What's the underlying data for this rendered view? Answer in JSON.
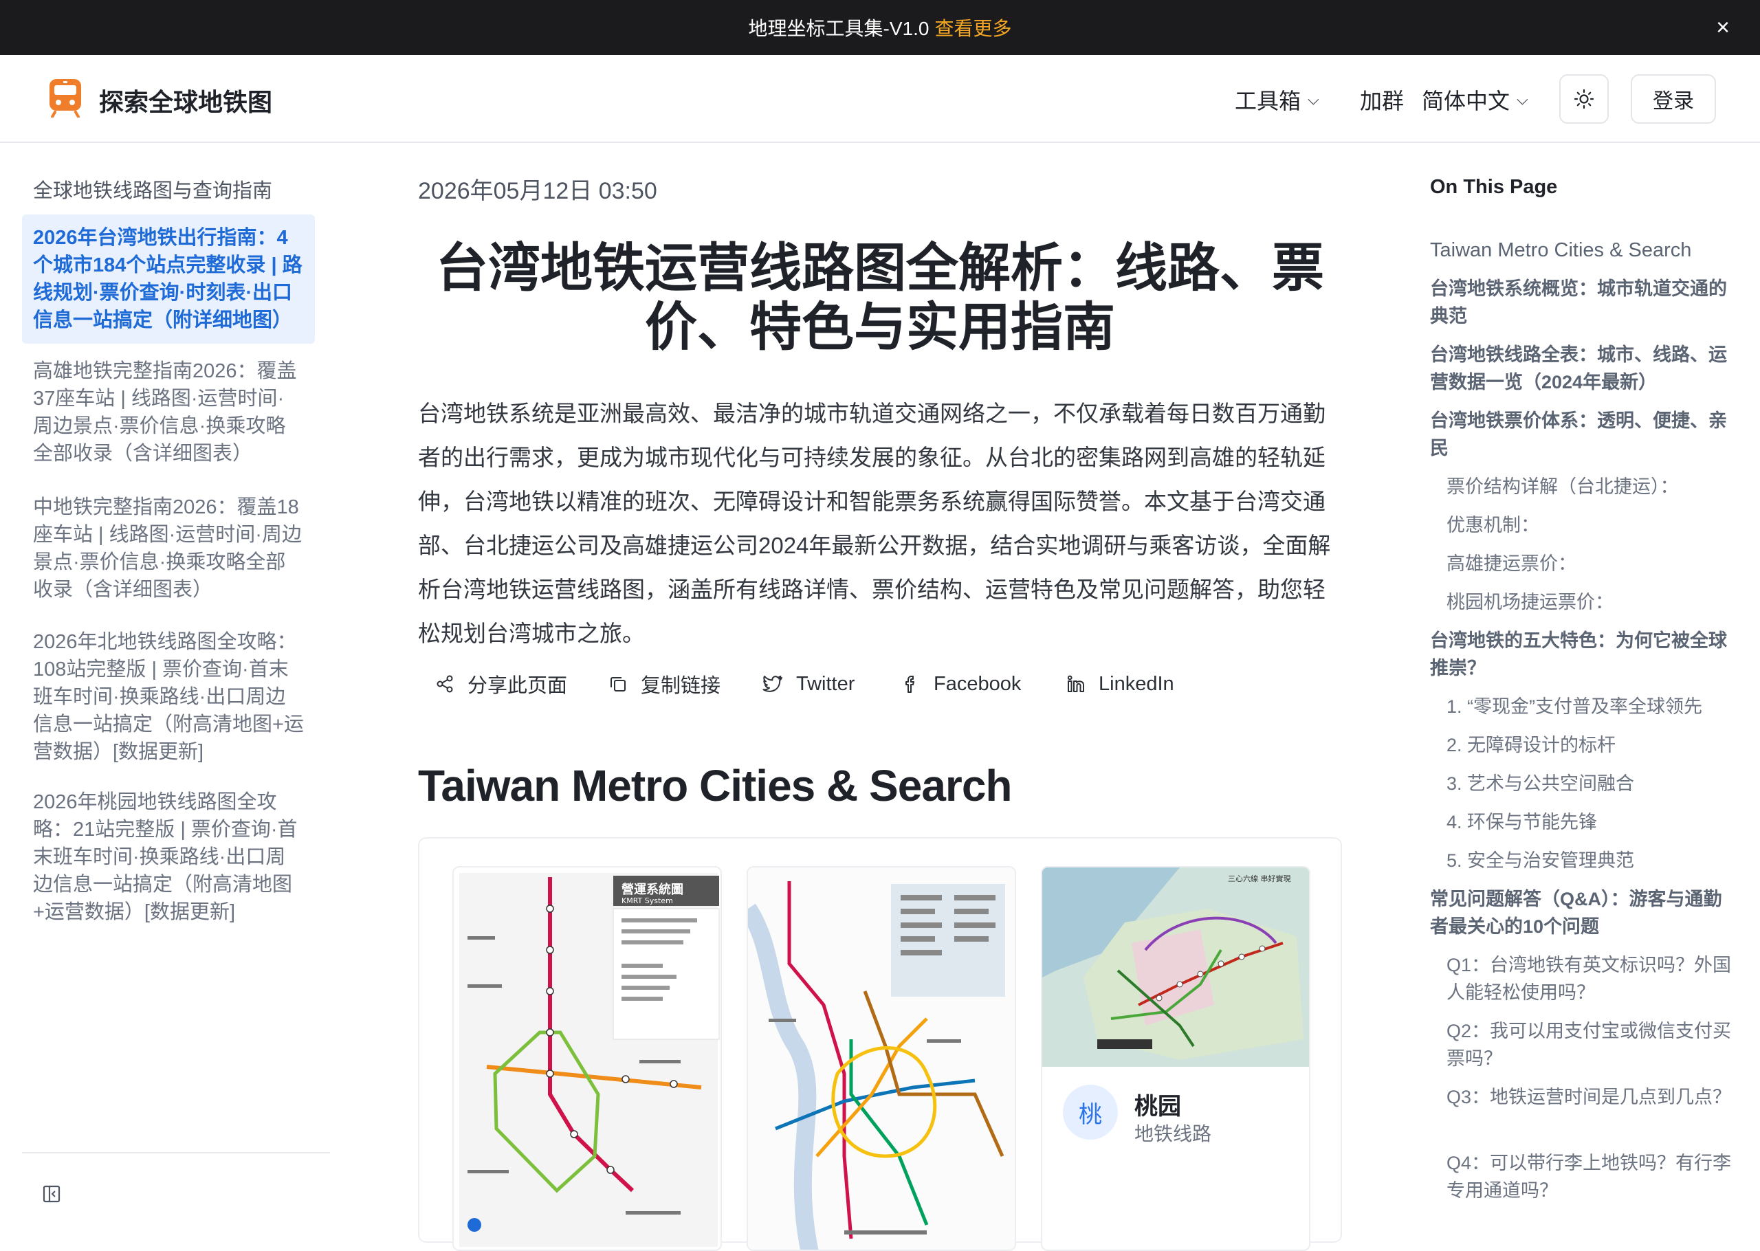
{
  "banner": {
    "text": "地理坐标工具集-V1.0",
    "link": "查看更多",
    "close": "×"
  },
  "header": {
    "site_title": "探索全球地铁图",
    "nav": {
      "toolbox": "工具箱",
      "join_group": "加群",
      "language": "简体中文",
      "login": "登录"
    }
  },
  "sidebar": {
    "heading": "全球地铁线路图与查询指南",
    "items": [
      {
        "label": "2026年台湾地铁出行指南：4个城市184个站点完整收录 | 路线规划·票价查询·时刻表·出口信息一站搞定（附详细地图）",
        "active": true
      },
      {
        "label": "高雄地铁完整指南2026：覆盖37座车站 | 线路图·运营时间·周边景点·票价信息·换乘攻略全部收录（含详细图表）"
      },
      {
        "label": "中地铁完整指南2026：覆盖18座车站 | 线路图·运营时间·周边景点·票价信息·换乘攻略全部收录（含详细图表）"
      },
      {
        "label": "2026年北地铁线路图全攻略：108站完整版 | 票价查询·首末班车时间·换乘路线·出口周边信息一站搞定（附高清地图+运营数据）[数据更新]"
      },
      {
        "label": "2026年桃园地铁线路图全攻略：21站完整版 | 票价查询·首末班车时间·换乘路线·出口周边信息一站搞定（附高清地图+运营数据）[数据更新]"
      }
    ]
  },
  "article": {
    "date": "2026年05月12日 03:50",
    "title": "台湾地铁运营线路图全解析：线路、票价、特色与实用指南",
    "intro": "台湾地铁系统是亚洲最高效、最洁净的城市轨道交通网络之一，不仅承载着每日数百万通勤者的出行需求，更成为城市现代化与可持续发展的象征。从台北的密集路网到高雄的轻轨延伸，台湾地铁以精准的班次、无障碍设计和智能票务系统赢得国际赞誉。本文基于台湾交通部、台北捷运公司及高雄捷运公司2024年最新公开数据，结合实地调研与乘客访谈，全面解析台湾地铁运营线路图，涵盖所有线路详情、票价结构、运营特色及常见问题解答，助您轻松规划台湾城市之旅。",
    "share": {
      "share_page": "分享此页面",
      "copy_link": "复制链接",
      "twitter": "Twitter",
      "facebook": "Facebook",
      "linkedin": "LinkedIn"
    },
    "section_title": "Taiwan Metro Cities & Search",
    "map_labels": {
      "kaohsiung_title": "營運系統圖",
      "kaohsiung_sub": "KMRT System",
      "taoyuan_caption": "三心六線 串好實現"
    },
    "cities": [
      {
        "badge": "桃",
        "name": "桃园",
        "sub": "地铁线路"
      }
    ]
  },
  "toc": {
    "heading": "On This Page",
    "items": [
      {
        "label": "Taiwan Metro Cities & Search",
        "level": 0
      },
      {
        "label": "台湾地铁系统概览：城市轨道交通的典范",
        "level": 1
      },
      {
        "label": "台湾地铁线路全表：城市、线路、运营数据一览（2024年最新）",
        "level": 1
      },
      {
        "label": "台湾地铁票价体系：透明、便捷、亲民",
        "level": 1
      },
      {
        "label": "票价结构详解（台北捷运）：",
        "level": 2
      },
      {
        "label": "优惠机制：",
        "level": 2
      },
      {
        "label": "高雄捷运票价：",
        "level": 2
      },
      {
        "label": "桃园机场捷运票价：",
        "level": 2
      },
      {
        "label": "台湾地铁的五大特色：为何它被全球推崇？",
        "level": 1
      },
      {
        "label": "1. “零现金”支付普及率全球领先",
        "level": 2
      },
      {
        "label": "2. 无障碍设计的标杆",
        "level": 2
      },
      {
        "label": "3. 艺术与公共空间融合",
        "level": 2
      },
      {
        "label": "4. 环保与节能先锋",
        "level": 2
      },
      {
        "label": "5. 安全与治安管理典范",
        "level": 2
      },
      {
        "label": "常见问题解答（Q&A）：游客与通勤者最关心的10个问题",
        "level": 1
      },
      {
        "label": "Q1：台湾地铁有英文标识吗？外国人能轻松使用吗？",
        "level": 2
      },
      {
        "label": "Q2：我可以用支付宝或微信支付买票吗？",
        "level": 2
      },
      {
        "label": "Q3：地铁运营时间是几点到几点？",
        "level": 2
      },
      {
        "label": "Q4：可以带行李上地铁吗？有行李专用通道吗？",
        "level": 2
      }
    ]
  },
  "colors": {
    "accent": "#1e6ad6",
    "banner_link": "#f5a623",
    "logo": "#f07d2a"
  }
}
